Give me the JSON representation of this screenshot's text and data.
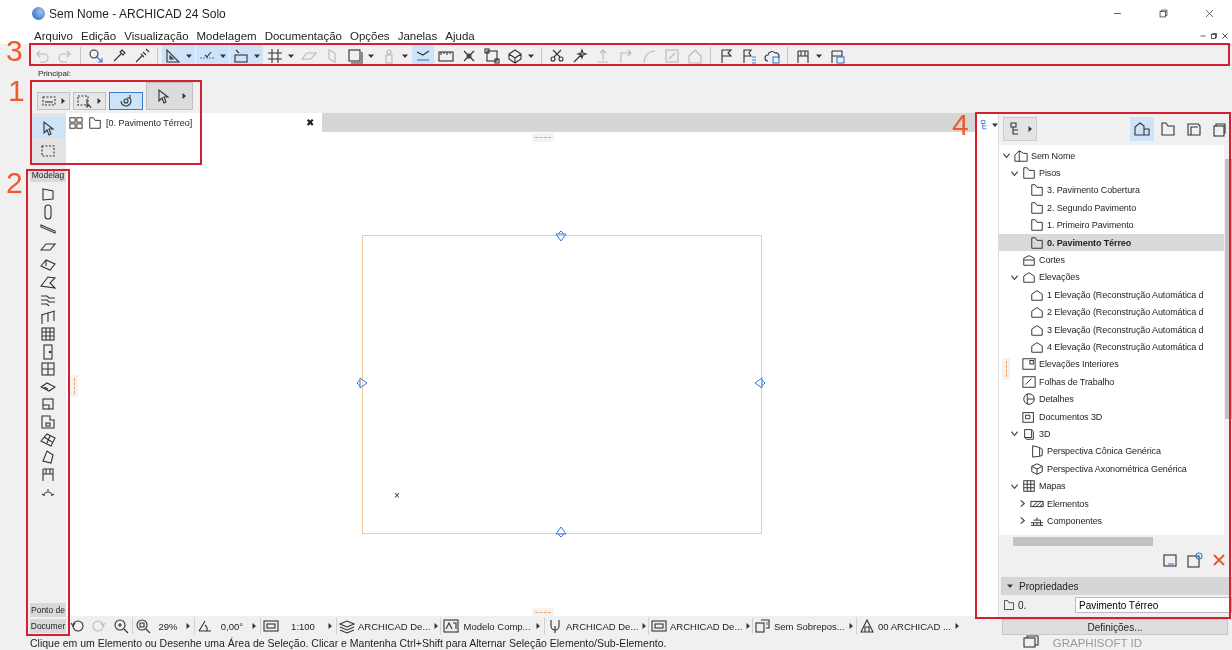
{
  "window": {
    "title": "Sem Nome - ARCHICAD 24 Solo"
  },
  "menu": [
    "Arquivo",
    "Edição",
    "Visualização",
    "Modelagem",
    "Documentação",
    "Opções",
    "Janelas",
    "Ajuda"
  ],
  "toolbar": [
    {
      "kind": "button",
      "on": false,
      "disabled": true,
      "menu": false
    },
    {
      "kind": "button",
      "on": false,
      "disabled": true,
      "menu": false
    },
    {
      "kind": "separator"
    },
    {
      "kind": "button",
      "on": false,
      "disabled": false,
      "menu": false
    },
    {
      "kind": "button",
      "on": false,
      "disabled": false,
      "menu": false
    },
    {
      "kind": "button",
      "on": false,
      "disabled": false,
      "menu": false
    },
    {
      "kind": "separator"
    },
    {
      "kind": "button",
      "on": true,
      "disabled": false,
      "menu": true
    },
    {
      "kind": "button",
      "on": true,
      "disabled": false,
      "menu": true
    },
    {
      "kind": "button",
      "on": true,
      "disabled": false,
      "menu": true
    },
    {
      "kind": "button",
      "on": false,
      "disabled": false,
      "menu": true
    },
    {
      "kind": "button",
      "on": false,
      "disabled": true,
      "menu": false
    },
    {
      "kind": "button",
      "on": false,
      "disabled": true,
      "menu": false
    },
    {
      "kind": "button",
      "on": false,
      "disabled": false,
      "menu": true
    },
    {
      "kind": "button",
      "on": false,
      "disabled": true,
      "menu": true
    },
    {
      "kind": "button",
      "on": true,
      "disabled": false,
      "menu": false
    },
    {
      "kind": "button",
      "on": false,
      "disabled": false,
      "menu": false
    },
    {
      "kind": "button",
      "on": false,
      "disabled": false,
      "menu": false
    },
    {
      "kind": "button",
      "on": false,
      "disabled": false,
      "menu": false
    },
    {
      "kind": "button",
      "on": false,
      "disabled": false,
      "menu": true
    },
    {
      "kind": "separator"
    },
    {
      "kind": "button",
      "on": false,
      "disabled": false,
      "menu": false
    },
    {
      "kind": "button",
      "on": false,
      "disabled": false,
      "menu": false
    },
    {
      "kind": "button",
      "on": false,
      "disabled": true,
      "menu": false
    },
    {
      "kind": "button",
      "on": false,
      "disabled": true,
      "menu": false
    },
    {
      "kind": "button",
      "on": false,
      "disabled": true,
      "menu": false
    },
    {
      "kind": "button",
      "on": false,
      "disabled": true,
      "menu": false
    },
    {
      "kind": "button",
      "on": false,
      "disabled": true,
      "menu": false
    },
    {
      "kind": "separator"
    },
    {
      "kind": "button",
      "on": false,
      "disabled": false,
      "menu": false
    },
    {
      "kind": "button",
      "on": false,
      "disabled": false,
      "menu": false
    },
    {
      "kind": "button",
      "on": false,
      "disabled": false,
      "menu": false
    },
    {
      "kind": "separator"
    },
    {
      "kind": "button",
      "on": false,
      "disabled": false,
      "menu": true
    },
    {
      "kind": "button",
      "on": false,
      "disabled": false,
      "menu": false
    }
  ],
  "toolbar_label": "Principal:",
  "info_box": [
    {
      "selected": false,
      "menu": true
    },
    {
      "selected": false,
      "menu": true
    },
    {
      "selected": true,
      "menu": false
    },
    {
      "selected": false,
      "menu": true
    }
  ],
  "toolbox": {
    "select_tools": [
      {
        "selected": true
      },
      {
        "selected": false
      }
    ],
    "header": "Modelag",
    "footers": [
      "Ponto de",
      "Documer"
    ]
  },
  "tab": {
    "label": "[0. Pavimento Térreo]",
    "close": "✖"
  },
  "canvas": {
    "marker": "×"
  },
  "status_bar": {
    "zoom_buttons": [
      {
        "disabled": false
      },
      {
        "disabled": true
      },
      {
        "disabled": false
      }
    ],
    "controls": [
      {
        "value": "29%"
      },
      {
        "value": "0,00°"
      },
      {
        "value": "1:100"
      },
      {
        "value": "ARCHICAD De..."
      },
      {
        "value": "Modelo Comp..."
      },
      {
        "value": "ARCHICAD De..."
      },
      {
        "value": "ARCHICAD De..."
      },
      {
        "value": "Sem Sobrepos..."
      },
      {
        "value": "00 ARCHICAD ..."
      }
    ],
    "message": "Clique em um Elemento ou Desenhe uma Área de Seleção. Clicar e Mantenha Ctrl+Shift para Alternar Seleção Elemento/Sub-Elemento.",
    "account": "GRAPHISOFT ID"
  },
  "navigator": {
    "views": [
      {
        "selected": true
      },
      {
        "selected": false
      },
      {
        "selected": false
      },
      {
        "selected": false
      }
    ],
    "tree": [
      {
        "kind": "project",
        "label": "Sem Nome",
        "expanded": true,
        "selected": false,
        "children": [
          {
            "kind": "floors",
            "label": "Pisos",
            "expanded": true,
            "selected": false,
            "children": [
              {
                "kind": "floor",
                "label": "3. Pavimento Cobertura",
                "selected": false
              },
              {
                "kind": "floor",
                "label": "2. Segundo Pavimento",
                "selected": false
              },
              {
                "kind": "floor",
                "label": "1. Primeiro Pavimento",
                "selected": false
              },
              {
                "kind": "floor",
                "label": "0. Pavimento Térreo",
                "selected": true
              }
            ]
          },
          {
            "kind": "section",
            "label": "Cortes",
            "selected": false
          },
          {
            "kind": "elevation",
            "label": "Elevações",
            "expanded": true,
            "selected": false,
            "children": [
              {
                "kind": "elevation",
                "label": "1 Elevação (Reconstrução Automática d",
                "selected": false
              },
              {
                "kind": "elevation",
                "label": "2 Elevação (Reconstrução Automática d",
                "selected": false
              },
              {
                "kind": "elevation",
                "label": "3 Elevação (Reconstrução Automática d",
                "selected": false
              },
              {
                "kind": "elevation",
                "label": "4 Elevação (Reconstrução Automática d",
                "selected": false
              }
            ]
          },
          {
            "kind": "interior",
            "label": "Elevações Interiores",
            "selected": false
          },
          {
            "kind": "worksheet",
            "label": "Folhas de Trabalho",
            "selected": false
          },
          {
            "kind": "detail",
            "label": "Detalhes",
            "selected": false
          },
          {
            "kind": "doc3d",
            "label": "Documentos 3D",
            "selected": false
          },
          {
            "kind": "view3d",
            "label": "3D",
            "expanded": true,
            "selected": false,
            "children": [
              {
                "kind": "perspective",
                "label": "Perspectiva Cônica Genérica",
                "selected": false
              },
              {
                "kind": "axon",
                "label": "Perspectiva Axonométrica Genérica",
                "selected": false
              }
            ]
          },
          {
            "kind": "schedules",
            "label": "Mapas",
            "expanded": true,
            "selected": false,
            "children": [
              {
                "kind": "elements",
                "label": "Elementos",
                "expanded": false,
                "selected": false
              },
              {
                "kind": "components",
                "label": "Componentes",
                "expanded": false,
                "selected": false
              }
            ]
          }
        ]
      }
    ],
    "properties": {
      "title": "Propriedades",
      "id": "0.",
      "name": "Pavimento Térreo"
    },
    "settings_button": "Definições..."
  },
  "annotations": [
    {
      "label": "3"
    },
    {
      "label": "1"
    },
    {
      "label": "2"
    },
    {
      "label": "4"
    }
  ]
}
